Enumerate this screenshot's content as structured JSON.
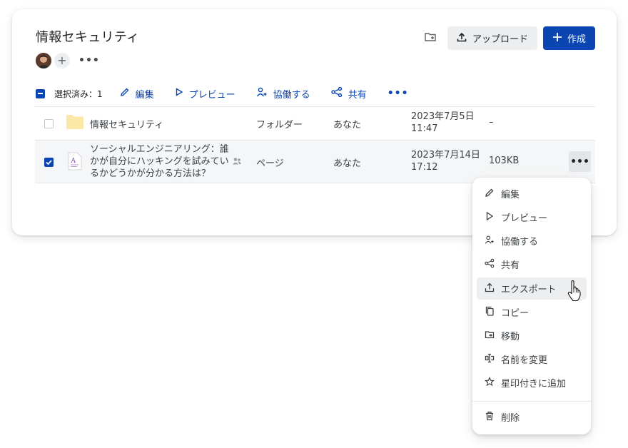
{
  "page": {
    "title": "情報セキュリティ",
    "avatar_more": "•••"
  },
  "actions": {
    "upload_label": "アップロード",
    "create_label": "作成"
  },
  "toolbar": {
    "selected_count": "選択済み：1",
    "edit": "編集",
    "preview": "プレビュー",
    "collaborate": "協働する",
    "share": "共有",
    "more": "•••"
  },
  "rows": [
    {
      "name": "情報セキュリティ",
      "type": "フォルダー",
      "owner": "あなた",
      "date": "2023年7月5日",
      "time": "11:47",
      "size": "–",
      "checked": false,
      "icon": "folder-icon"
    },
    {
      "name": "ソーシャルエンジニアリング：誰かが自分にハッキングを試みているかどうかが分かる方法は？",
      "name_line1": "ソーシャルエンジニアリング：誰",
      "name_line2": "かが自分にハッキングを試みてい",
      "name_line3": "るかどうかが分かる方法は？",
      "type": "ページ",
      "owner": "あなた",
      "date": "2023年7月14日",
      "time": "17:12",
      "size": "103KB",
      "checked": true,
      "icon": "page-doc-icon",
      "more": "•••"
    }
  ],
  "menu": {
    "items": [
      {
        "label": "編集",
        "icon": "pencil-icon"
      },
      {
        "label": "プレビュー",
        "icon": "play-outline-icon"
      },
      {
        "label": "協働する",
        "icon": "add-user-icon"
      },
      {
        "label": "共有",
        "icon": "share-icon"
      },
      {
        "label": "エクスポート",
        "icon": "export-icon",
        "hovered": true
      },
      {
        "label": "コピー",
        "icon": "copy-icon"
      },
      {
        "label": "移動",
        "icon": "move-folder-icon"
      },
      {
        "label": "名前を変更",
        "icon": "rename-icon"
      },
      {
        "label": "星印付きに追加",
        "icon": "star-icon"
      },
      {
        "label": "削除",
        "icon": "trash-icon"
      }
    ]
  },
  "colors": {
    "accent": "#0b45b2",
    "folder": "#fce8a6",
    "hover": "#eceef0"
  }
}
